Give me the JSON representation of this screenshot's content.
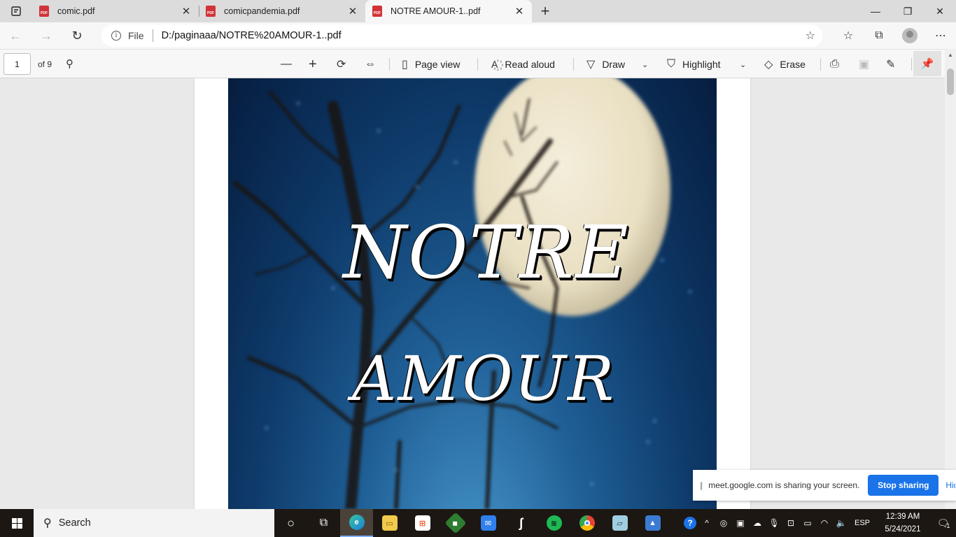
{
  "tabs": [
    {
      "title": "comic.pdf",
      "icon": "pdf-icon",
      "active": false
    },
    {
      "title": "comicpandemia.pdf",
      "icon": "pdf-icon",
      "active": false
    },
    {
      "title": "NOTRE AMOUR-1..pdf",
      "icon": "pdf-icon",
      "active": true
    }
  ],
  "address": {
    "scheme": "File",
    "url": "D:/paginaaa/NOTRE%20AMOUR-1..pdf"
  },
  "pdf_toolbar": {
    "page_number": "1",
    "page_total": "of 9",
    "page_view": "Page view",
    "read_aloud": "Read aloud",
    "draw": "Draw",
    "highlight": "Highlight",
    "erase": "Erase"
  },
  "document": {
    "title_line1": "NOTRE",
    "title_line2": "AMOUR"
  },
  "share_notice": {
    "message": "meet.google.com is sharing your screen.",
    "stop_label": "Stop sharing",
    "hide_label": "Hide"
  },
  "taskbar": {
    "search_label": "Search",
    "language": "ESP",
    "time": "12:39 AM",
    "date": "5/24/2021",
    "notification_count": "1"
  },
  "colors": {
    "accent": "#1a73e8",
    "pdf_icon": "#d13438",
    "taskbar": "#1c1712"
  }
}
